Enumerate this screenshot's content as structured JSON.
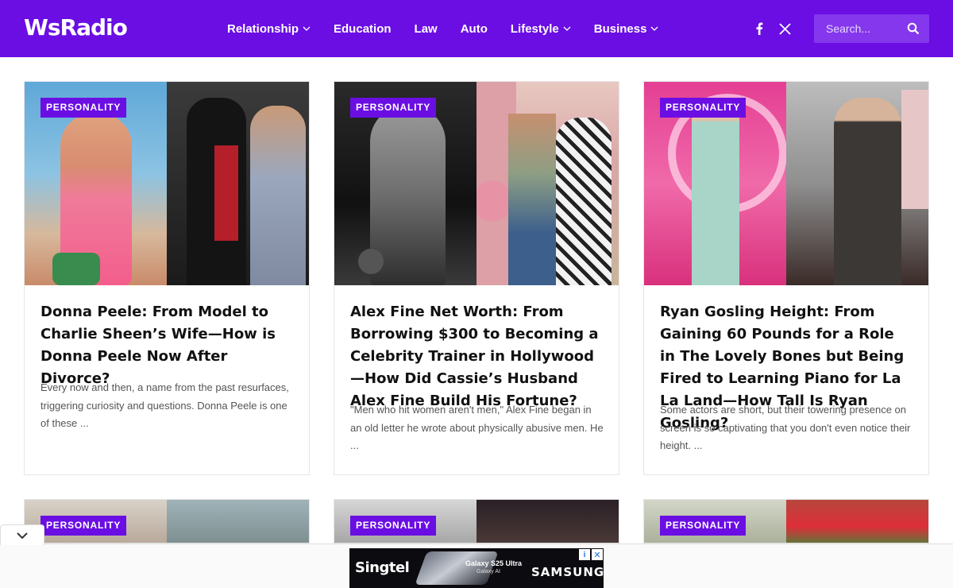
{
  "header": {
    "logo": "WsRadio",
    "nav": [
      {
        "label": "Relationship",
        "dropdown": true
      },
      {
        "label": "Education",
        "dropdown": false
      },
      {
        "label": "Law",
        "dropdown": false
      },
      {
        "label": "Auto",
        "dropdown": false
      },
      {
        "label": "Lifestyle",
        "dropdown": true
      },
      {
        "label": "Business",
        "dropdown": true
      }
    ],
    "social": [
      "facebook-icon",
      "x-icon"
    ],
    "search_placeholder": "Search..."
  },
  "colors": {
    "brand": "#6a0ee3",
    "search_bg": "#8537ee"
  },
  "cards": [
    {
      "category": "PERSONALITY",
      "title": "Donna Peele: From Model to Charlie Sheen’s Wife—How is Donna Peele Now After Divorce?",
      "excerpt": "Every now and then, a name from the past resurfaces, triggering curiosity and questions. Donna Peele is one of these ..."
    },
    {
      "category": "PERSONALITY",
      "title": "Alex Fine Net Worth: From Borrowing $300 to Becoming a Celebrity Trainer in Hollywood—How Did Cassie’s Husband Alex Fine Build His Fortune?",
      "excerpt": "\"Men who hit women aren't men,\" Alex Fine began in an old letter he wrote about physically abusive men. He ..."
    },
    {
      "category": "PERSONALITY",
      "title": "Ryan Gosling Height: From Gaining 60 Pounds for a Role in The Lovely Bones but Being Fired to Learning Piano for La La Land—How Tall Is Ryan Gosling?",
      "excerpt": "Some actors are short, but their towering presence on screen is so captivating that you don't even notice their height. ..."
    }
  ],
  "cards_row2": [
    {
      "category": "PERSONALITY"
    },
    {
      "category": "PERSONALITY"
    },
    {
      "category": "PERSONALITY"
    }
  ],
  "ad": {
    "brand_left": "Singtel",
    "product": "Galaxy S25 Ultra",
    "product_sub": "Galaxy AI",
    "brand_right": "SAMSUNG"
  }
}
